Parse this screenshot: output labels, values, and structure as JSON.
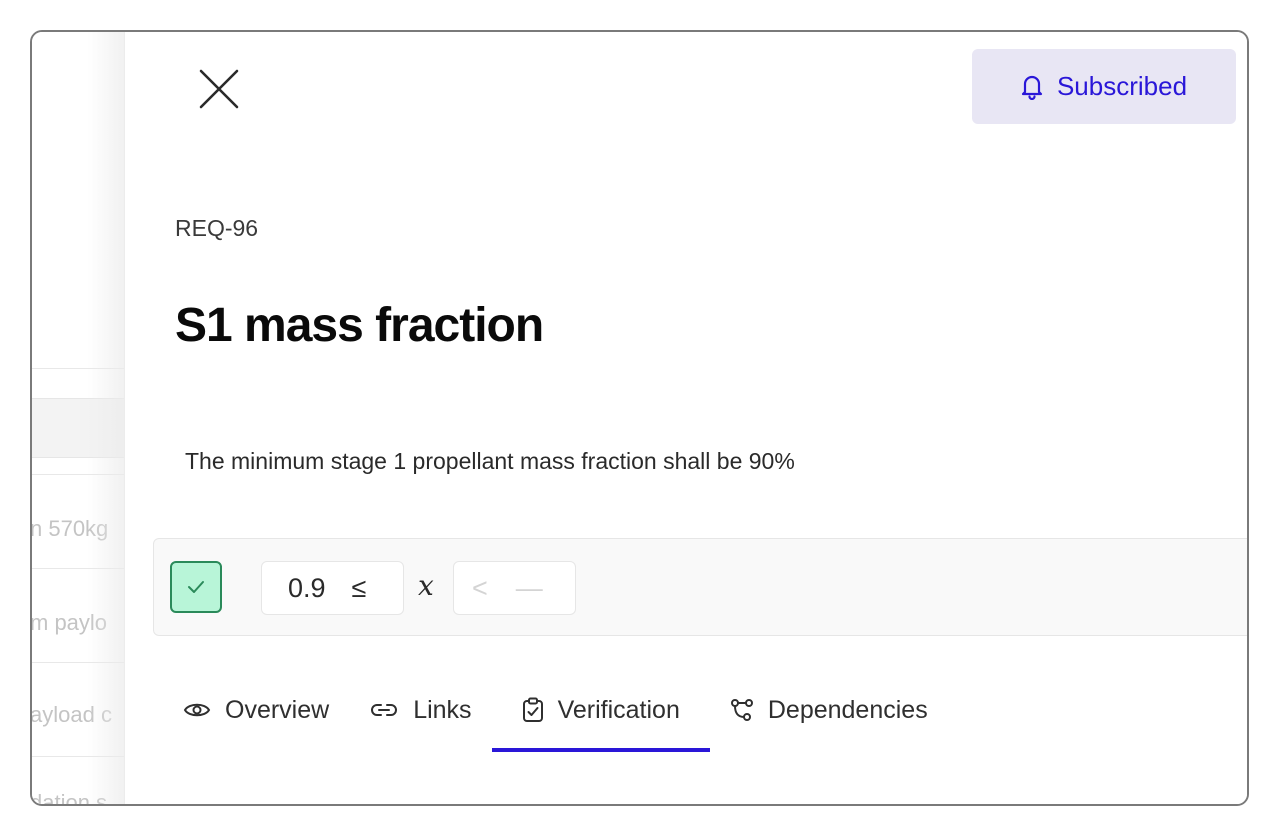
{
  "background_list": {
    "rows": [
      {
        "text": "n 570kg"
      },
      {
        "text": "m paylo"
      },
      {
        "text": "ayload c"
      },
      {
        "text": "dation s"
      }
    ]
  },
  "panel": {
    "close_icon": "close-icon",
    "subscribe_button": {
      "label": "Subscribed",
      "icon": "bell-icon",
      "color": "#2a17d8",
      "background": "#e8e6f4"
    },
    "requirement_id": "REQ-96",
    "title": "S1 mass fraction",
    "description": "The minimum stage 1 propellant mass fraction shall be 90%",
    "constraint": {
      "verified": true,
      "status_color": "#b8f5d8",
      "lower_value": "0.9",
      "lower_operator": "≤",
      "variable": "x",
      "upper_operator": "<",
      "upper_value": "—"
    },
    "tabs": [
      {
        "label": "Overview",
        "icon": "eye-icon",
        "active": false
      },
      {
        "label": "Links",
        "icon": "link-icon",
        "active": false
      },
      {
        "label": "Verification",
        "icon": "clipboard-check-icon",
        "active": true
      },
      {
        "label": "Dependencies",
        "icon": "dependencies-icon",
        "active": false
      }
    ],
    "accent_color": "#2a17d8"
  }
}
